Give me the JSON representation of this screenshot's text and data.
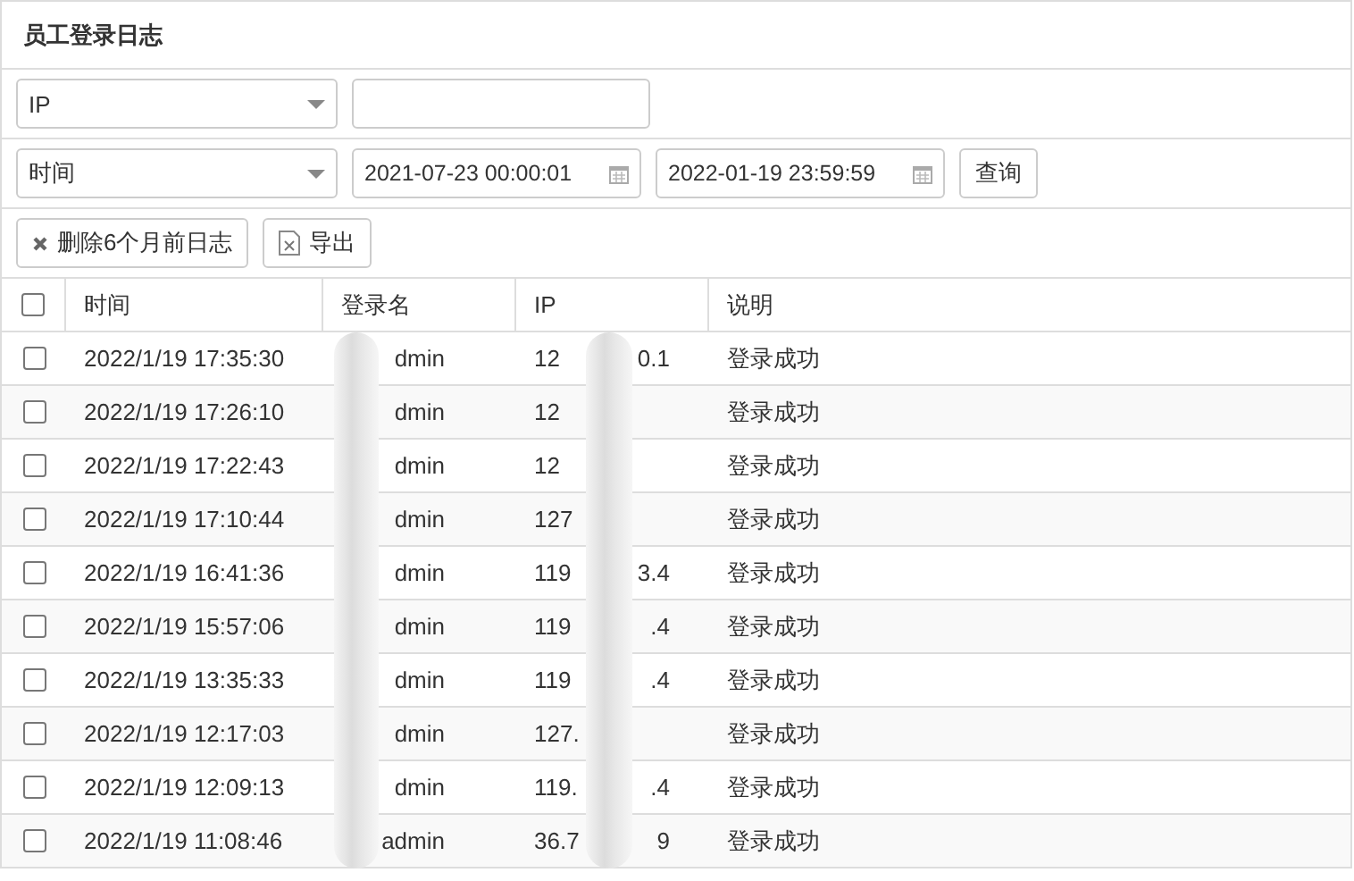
{
  "panel": {
    "title": "员工登录日志"
  },
  "filters": [
    {
      "kind": "text",
      "field": "IP"
    },
    {
      "kind": "range",
      "field": "时间",
      "from": "2021-07-23 00:00:01",
      "to": "2022-01-19 23:59:59",
      "button": "查询"
    }
  ],
  "toolbar": [
    {
      "kind": "delete",
      "label": "删除6个月前日志"
    },
    {
      "kind": "export",
      "label": "导出"
    }
  ],
  "table": {
    "columns": [
      "时间",
      "登录名",
      "IP",
      "说明"
    ],
    "all_checked": false,
    "rows": [
      {
        "checked": false,
        "time": "2022/1/19 17:35:30",
        "login": "dmin",
        "ip_start": "12",
        "ip_end": "0.1",
        "note": "登录成功"
      },
      {
        "checked": false,
        "time": "2022/1/19 17:26:10",
        "login": "dmin",
        "ip_start": "12",
        "note": "登录成功"
      },
      {
        "checked": false,
        "time": "2022/1/19 17:22:43",
        "login": "dmin",
        "ip_start": "12",
        "note": "登录成功"
      },
      {
        "checked": false,
        "time": "2022/1/19 17:10:44",
        "login": "dmin",
        "ip_start": "127",
        "note": "登录成功"
      },
      {
        "checked": false,
        "time": "2022/1/19 16:41:36",
        "login": "dmin",
        "ip_start": "119",
        "ip_end": "3.4",
        "note": "登录成功"
      },
      {
        "checked": false,
        "time": "2022/1/19 15:57:06",
        "login": "dmin",
        "ip_start": "119",
        "ip_end": ".4",
        "note": "登录成功"
      },
      {
        "checked": false,
        "time": "2022/1/19 13:35:33",
        "login": "dmin",
        "ip_start": "119",
        "ip_end": ".4",
        "note": "登录成功"
      },
      {
        "checked": false,
        "time": "2022/1/19 12:17:03",
        "login": "dmin",
        "ip_start": "127.",
        "note": "登录成功"
      },
      {
        "checked": false,
        "time": "2022/1/19 12:09:13",
        "login": "dmin",
        "ip_start": "119.",
        "ip_end": ".4",
        "note": "登录成功"
      },
      {
        "checked": false,
        "time": "2022/1/19 11:08:46",
        "login": "admin",
        "ip_start": "36.7",
        "ip_end": "9",
        "note": "登录成功"
      }
    ]
  }
}
